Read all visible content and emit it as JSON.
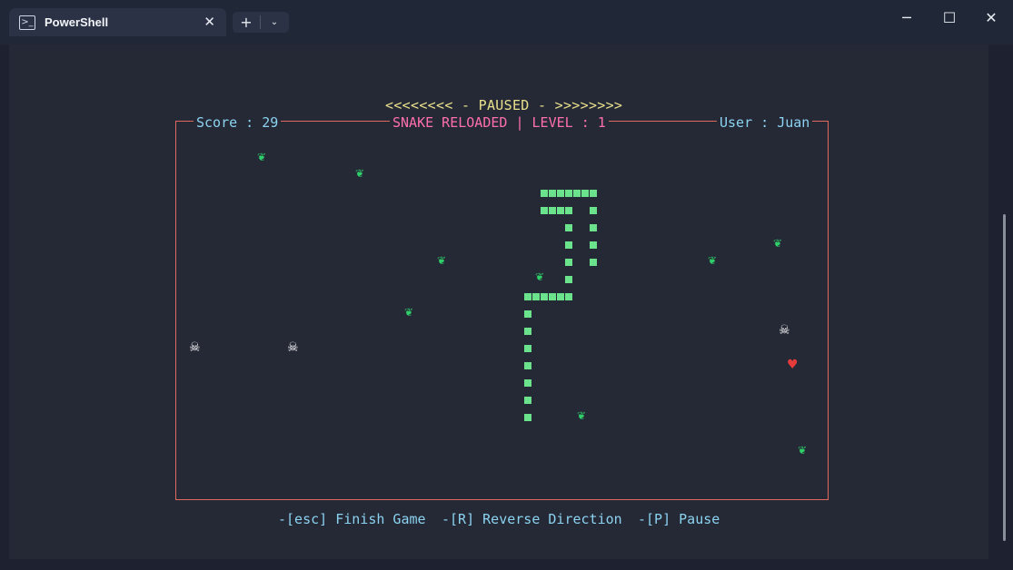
{
  "window": {
    "tab_title": "PowerShell",
    "tab_icon": "terminal-icon",
    "close_tab_icon": "close-icon",
    "new_tab_icon": "plus-icon",
    "dropdown_icon": "chevron-down-icon",
    "minimize_icon": "minimize-icon",
    "maximize_icon": "maximize-icon",
    "close_window_icon": "close-icon"
  },
  "game": {
    "status": "<<<<<<<< - PAUSED - >>>>>>>>",
    "score_label": "Score : 29",
    "title": "SNAKE RELOADED | LEVEL : 1",
    "user_label": "User : Juan",
    "hints": [
      "-[esc] Finish Game",
      "-[R] Reverse Direction",
      "-[P] Pause"
    ],
    "score": 29,
    "level": 1,
    "user": "Juan",
    "colors": {
      "border": "#e06a5e",
      "snake": "#6be38c",
      "text_cyan": "#8bd3f0",
      "text_pink": "#ff6fae",
      "text_yellow": "#e9e08c"
    },
    "items": {
      "food_icon": "herb-icon",
      "hazard_icon": "skull-icon",
      "life_icon": "heart-icon",
      "food_count": 10,
      "hazard_count": 3,
      "life_count": 1
    }
  }
}
